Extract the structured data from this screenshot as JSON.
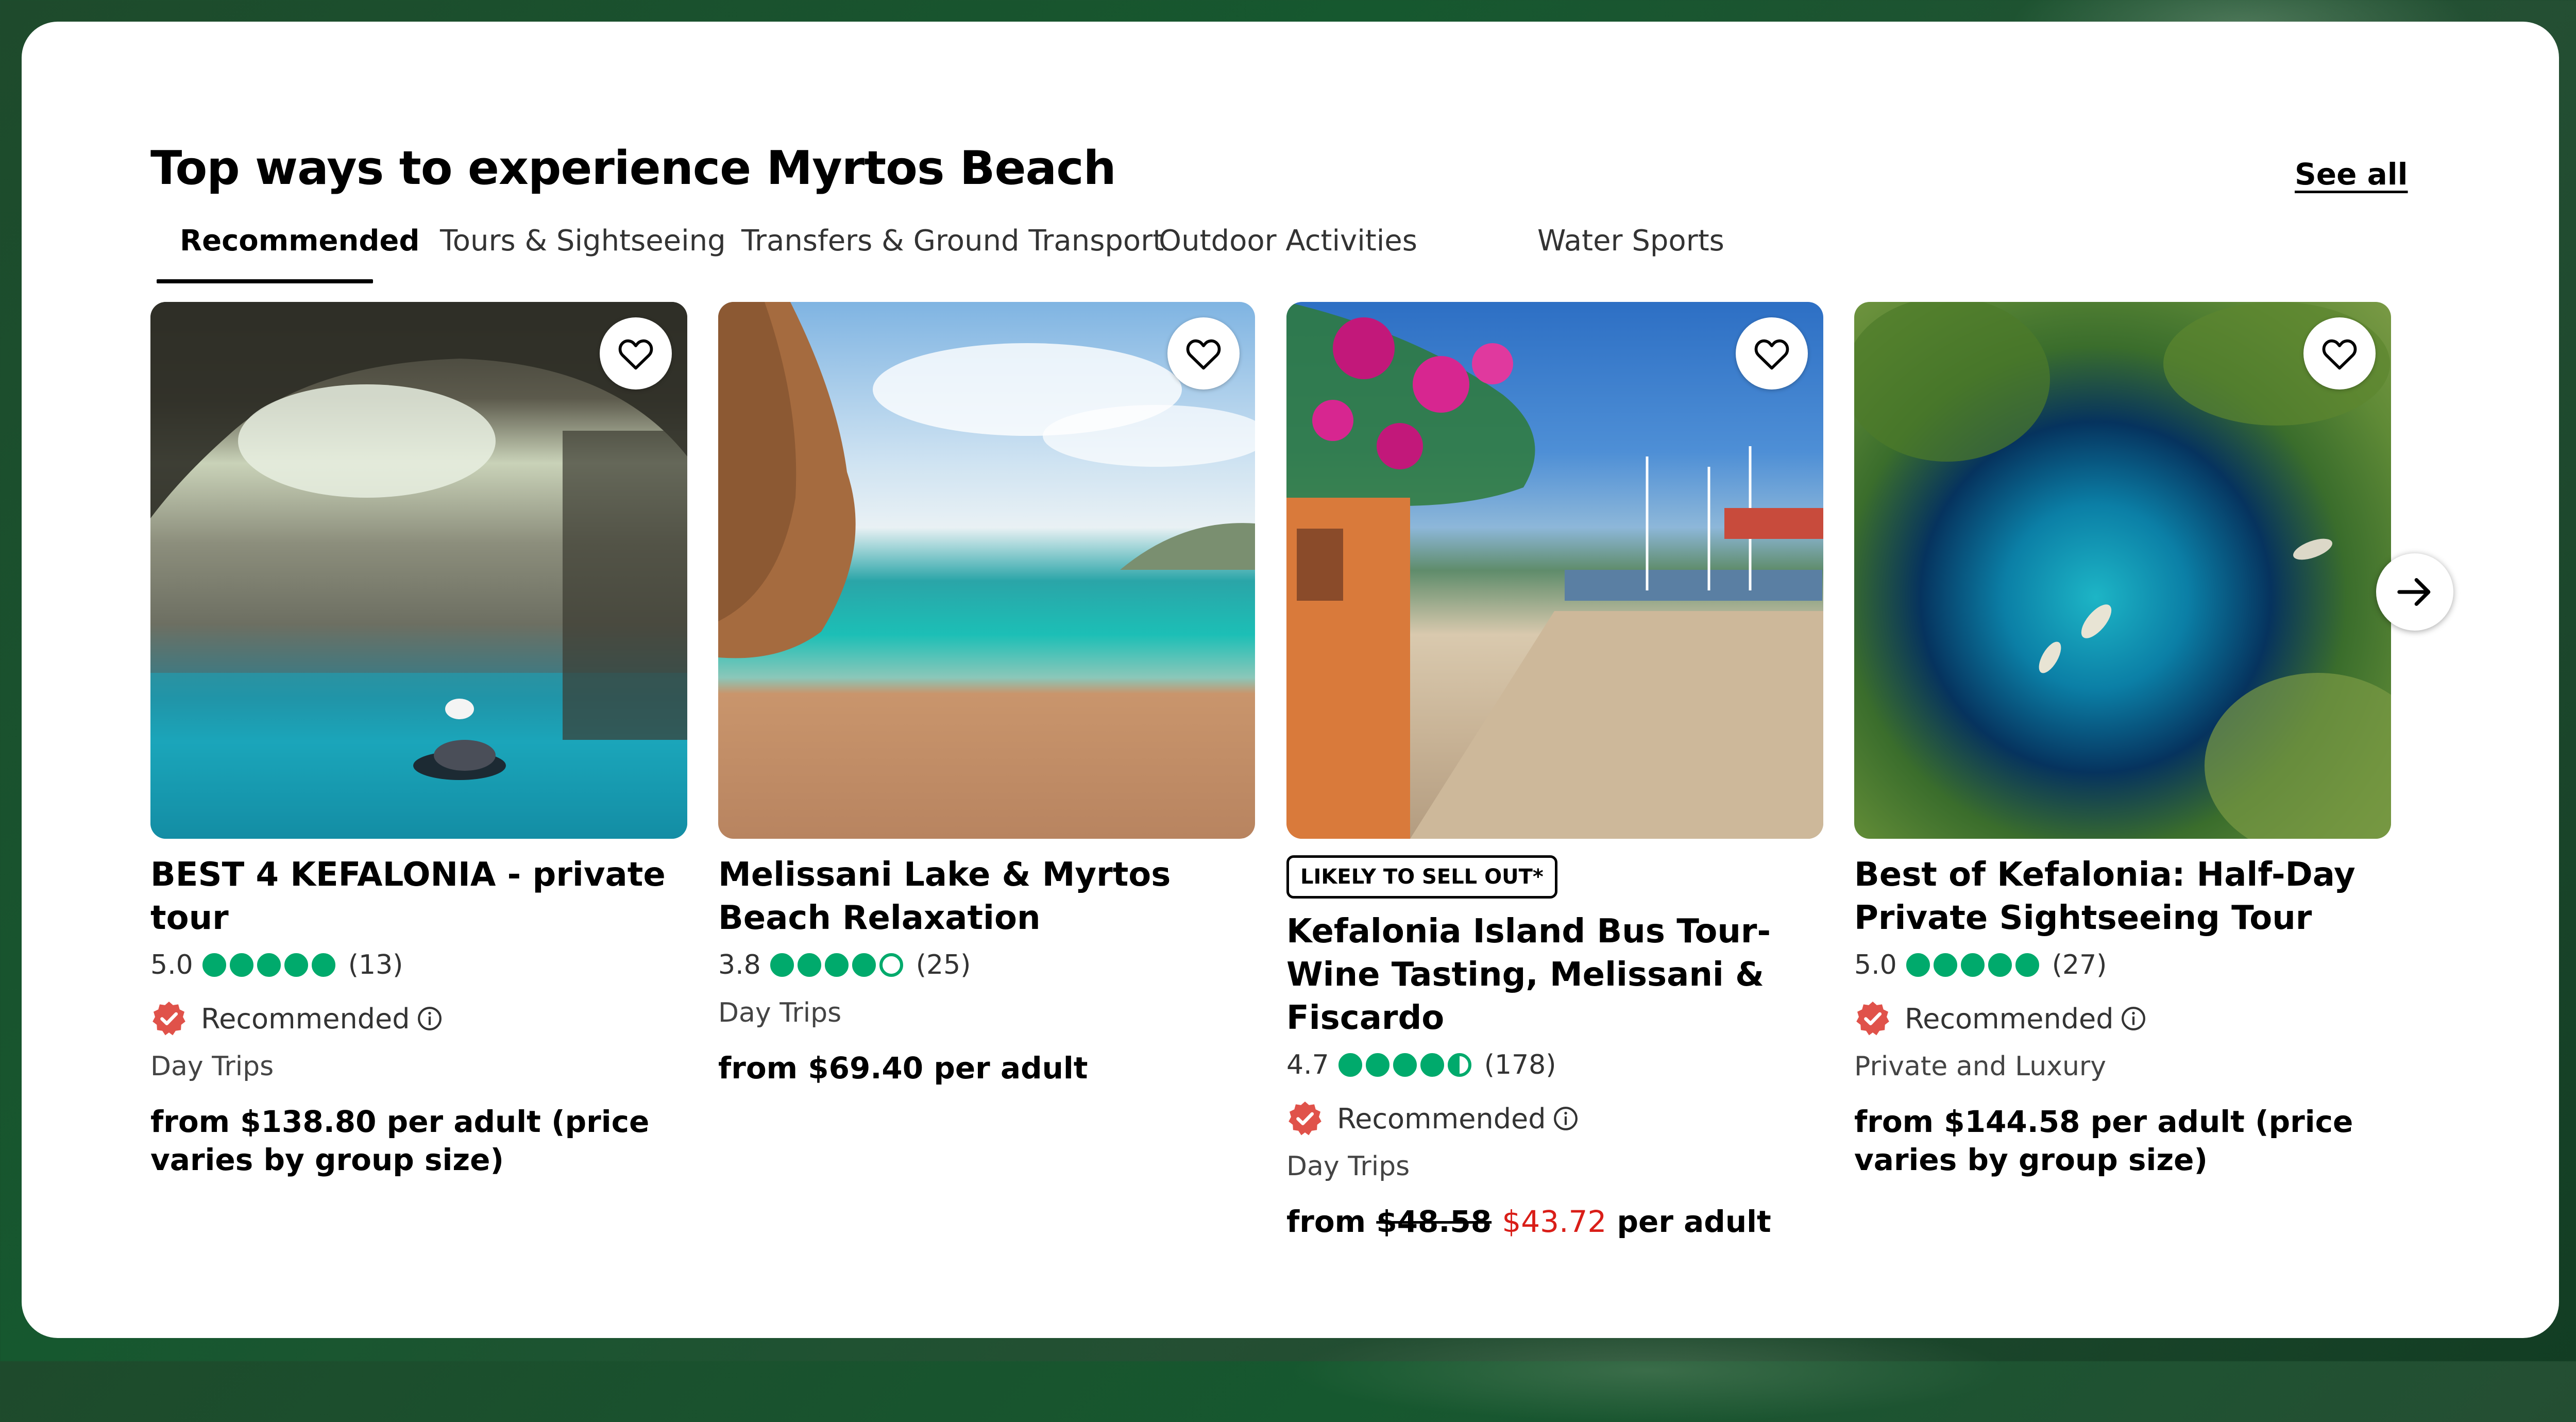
{
  "section": {
    "title": "Top ways to experience Myrtos Beach",
    "see_all": "See all"
  },
  "tabs": [
    {
      "label": "Recommended",
      "active": true
    },
    {
      "label": "Tours & Sightseeing"
    },
    {
      "label": "Transfers & Ground Transport"
    },
    {
      "label": "Outdoor Activities"
    },
    {
      "label": "Water Sports"
    }
  ],
  "cards": [
    {
      "title": "BEST 4 KEFALONIA - private tour",
      "rating": "5.0",
      "bubbles": 5,
      "reviews": "(13)",
      "recommended": "Recommended",
      "category": "Day Trips",
      "price": "from $138.80 per adult (price varies by group size)"
    },
    {
      "title": "Melissani Lake & Myrtos Beach Relaxation",
      "rating": "3.8",
      "bubbles": 4,
      "reviews": "(25)",
      "category": "Day Trips",
      "price": "from $69.40 per adult"
    },
    {
      "badge": "LIKELY TO SELL OUT*",
      "title": "Kefalonia Island Bus Tour- Wine Tasting, Melissani & Fiscardo",
      "rating": "4.7",
      "bubbles": 4.5,
      "reviews": "(178)",
      "recommended": "Recommended",
      "category": "Day Trips",
      "price_prefix": "from",
      "price_old": "$48.58",
      "price_new": "$43.72",
      "price_suffix": "per adult"
    },
    {
      "title": "Best of Kefalonia: Half-Day Private Sightseeing Tour",
      "rating": "5.0",
      "bubbles": 5,
      "reviews": "(27)",
      "recommended": "Recommended",
      "category": "Private and Luxury",
      "price": "from $144.58 per adult (price varies by group size)"
    }
  ],
  "colors": {
    "rating_green": "#00aa6c",
    "sale_red": "#d91e18",
    "recommended_badge": "#e0524a"
  },
  "icons": {
    "save": "heart-icon",
    "next": "arrow-right-icon",
    "info": "info-icon",
    "recommended": "recommended-badge-icon"
  }
}
